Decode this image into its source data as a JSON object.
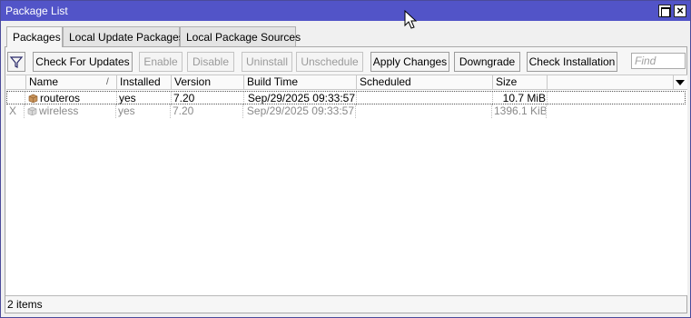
{
  "window": {
    "title": "Package List"
  },
  "tabs": [
    {
      "label": "Packages",
      "active": true
    },
    {
      "label": "Local Update Packages",
      "active": false
    },
    {
      "label": "Local Package Sources",
      "active": false
    }
  ],
  "toolbar": {
    "check_for_updates": "Check For Updates",
    "enable": "Enable",
    "disable": "Disable",
    "uninstall": "Uninstall",
    "unschedule": "Unschedule",
    "apply_changes": "Apply Changes",
    "downgrade": "Downgrade",
    "check_installation": "Check Installation",
    "find_placeholder": "Find"
  },
  "table": {
    "columns": [
      "Name",
      "Installed",
      "Version",
      "Build Time",
      "Scheduled",
      "Size"
    ],
    "rows": [
      {
        "flag": "",
        "name": "routeros",
        "installed": "yes",
        "version": "7.20",
        "build_time": "Sep/29/2025 09:33:57",
        "scheduled": "",
        "size": "10.7 MiB",
        "icon": "package-icon",
        "disabled": false,
        "selected": true
      },
      {
        "flag": "X",
        "name": "wireless",
        "installed": "yes",
        "version": "7.20",
        "build_time": "Sep/29/2025 09:33:57",
        "scheduled": "",
        "size": "1396.1 KiB",
        "icon": "package-icon",
        "disabled": true,
        "selected": false
      }
    ]
  },
  "status": {
    "items": "2 items"
  },
  "colors": {
    "titlebar": "#5254c8",
    "package_icon": "#c8935a"
  }
}
